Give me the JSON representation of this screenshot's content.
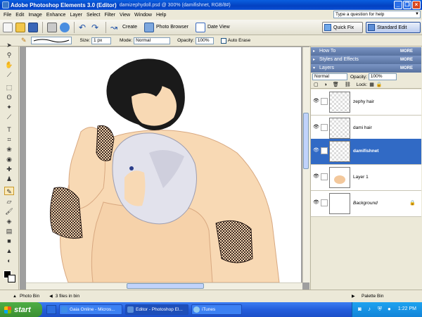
{
  "window": {
    "app_title": "Adobe Photoshop Elements 3.0 (Editor)",
    "doc_title": "damizephydoll.psd @ 300% (damifishnet, RGB/8#)"
  },
  "menu": [
    "File",
    "Edit",
    "Image",
    "Enhance",
    "Layer",
    "Select",
    "Filter",
    "View",
    "Window",
    "Help"
  ],
  "help_placeholder": "Type a question for help",
  "shortcuts": {
    "create": "Create",
    "photo_browser": "Photo Browser",
    "date_view": "Date View",
    "quick_fix": "Quick Fix",
    "standard_edit": "Standard Edit"
  },
  "options": {
    "size_label": "Size:",
    "size_value": "1 px",
    "mode_label": "Mode:",
    "mode_value": "Normal",
    "opacity_label": "Opacity:",
    "opacity_value": "100%",
    "auto_erase": "Auto Erase"
  },
  "palettes": {
    "howto": "How To",
    "styles": "Styles and Effects",
    "layers": "Layers",
    "more": "MORE"
  },
  "layers_panel": {
    "blend_mode": "Normal",
    "opacity_label": "Opacity:",
    "opacity_value": "100%",
    "lock_label": "Lock:",
    "layers": [
      {
        "name": "zephy hair",
        "selected": false
      },
      {
        "name": "dami hair",
        "selected": false
      },
      {
        "name": "damifishnet",
        "selected": true
      },
      {
        "name": "Layer 1",
        "selected": false
      },
      {
        "name": "Background",
        "selected": false
      }
    ]
  },
  "bin": {
    "photo_bin": "Photo Bin",
    "files": "3 files in bin",
    "palette_bin": "Palette Bin"
  },
  "taskbar": {
    "start": "start",
    "tasks": [
      "Gaia Online - Micros...",
      "Editor - Photoshop El...",
      "iTunes"
    ],
    "clock": "1:22 PM"
  },
  "colors": {
    "title_blue": "#0341c0",
    "selection_blue": "#316ac5",
    "palette_header": "#6a84b3",
    "skin": "#f8d9b4",
    "hair_black": "#1a1a1a",
    "hair_silver": "#d8d8e8"
  }
}
